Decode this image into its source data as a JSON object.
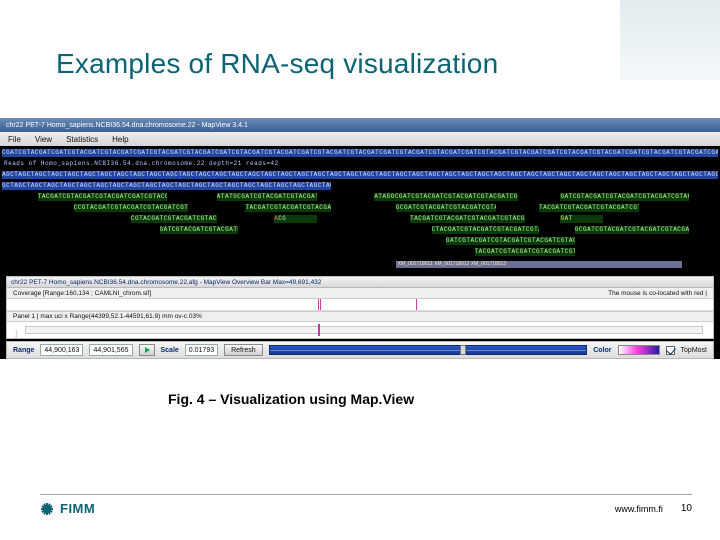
{
  "title": "Examples of RNA-seq visualization",
  "caption": "Fig. 4 – Visualization using Map.View",
  "footer": {
    "brand": "FIMM",
    "url": "www.fimm.fi",
    "page": "10"
  },
  "window": {
    "titlebar": "chr22 PET-7 Homo_sapiens.NCBI36.54.dna.chromosome.22 - MapView 3.4.1",
    "menu": [
      "File",
      "View",
      "Statistics",
      "Help"
    ]
  },
  "reads": {
    "blue_top": "CGATCGTACGATCGATCGTACGATCGTACGATCGATCGTACGATCGTACGATCGATCGTACGATCGTACGATCGATCGTACGATCGTACGATCGATCGTACGATCGTACGATCGATCGTACGATCGTACGATCGATCGTACGATCGTACGATCGATCGTACGATCGTACGATCGATCGTACGATCGTACGATCGATCGTAC",
    "label_row": "Reads of Homo_sapiens.NCBI36.54.dna.chromosome.22    depth=21 reads=42",
    "blue_bottom": "AGCTAGCTAGCTAGCTAGCTAGCTAGCTAGCTAGCTAGCTAGCTAGCTAGCTAGCTAGCTAGCTAGCTAGCTAGCTAGCTAGCTAGCTAGCTAGCTAGCTAGCTAGCTAGCTAGCTAGCTAGCTAGCTAGCTAGCTAGCTAGCTAGCTAGCTAGCTAGCTAGCTAGCTAGCTAGCTAGCTAGCTAGCTAGCTAGCTAGCT",
    "blue_bottom2": "GCTAGCTAGCTAGCTAGCTAGCTAGCTAGCTAGCTAGCTAGCTAGCTAGCTAGCTAGCTAGCTAGCTAGCTAGCTAGCTAGCT",
    "g1": "TACGATCGTACGATCGTACGATCGATCGTACGATCGTACG",
    "g2": "CCGTACGATCGTACGATCGTACGATCGTACGATCGT",
    "g3": "CGTACGATCGTACGATCGTACGATCG",
    "g4": "GATCGTACGATCGTACGATCGTA",
    "g5": "ATATGCGATCGTACGATCGTACGATCGTACG",
    "g6": "TACGATCGTACGATCGTACGATCG",
    "g7": "ATAGGCGATCGTACGATCGTACGATCGTACGATCGTACG",
    "g8": "GCGATCGTACGATCGTACGATCGTACG",
    "g9": "TACGATCGTACGATCGTACGATCGTACGATCG",
    "g10": "CTACGATCGTACGATCGTACGATCGTACGAT",
    "g11": "GATCGTACGATCGTACGATCGTACGATCGTACGATCGTAC",
    "g12": "TACGATCGTACGATCGTACGATCGTACG",
    "g13": "GCGATCGTACGATCGTACGATCGTACGATCGTACG",
    "annot": "XM_001718011  XM_001718012  XM_001718013"
  },
  "overview": {
    "title": "chr22 PET-7 Homo_sapiens.NCBI36.54.dna.chromosome.22.afg - MapView Overview Bar Max=49,691,432",
    "sub_left": "Coverage [Range:160,134 ;  CAMLNI_chrom.sif]",
    "sub_right": "The mouse is co-located with red |",
    "panel_left": "Panel 1 | max uci x  Range(44399,52.1-44591,61.9) mm ov-c.03%"
  },
  "toolbar": {
    "range_label": "Range",
    "range_from": "44,900,163",
    "range_to": "44,901,565",
    "top_label": "Top",
    "scale_label": "Scale",
    "scale_value": "0.01793",
    "refresh_btn": "Refresh",
    "color_label": "Color",
    "topmost_label": "TopMost"
  }
}
